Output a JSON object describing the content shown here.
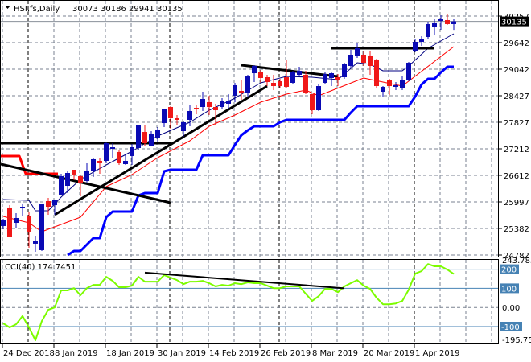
{
  "header": {
    "menu_icon": "triangle-down-icon",
    "symbol": "HSI,fs,Daily",
    "ohlc": "30073 30186 29941 30135"
  },
  "indicator_header": {
    "label": "CCI(40) 174.7451"
  },
  "colors": {
    "bull_candle": "#0a0ab4",
    "bear_candle": "#f01818",
    "fast_ma": "#000080",
    "slow_ma": "#ff0000",
    "lower_band": "#0000ff",
    "upper_band": "#ff0000",
    "trendline": "#000000",
    "cci_line": "#7cfc00",
    "cci_levels": "#4682b4",
    "grid": "#7a8290",
    "current_price_bg": "#000000"
  },
  "chart_data": [
    {
      "type": "candlestick",
      "title": "HSI,fs,Daily",
      "grid": true,
      "y_ticks": [
        30257,
        29642,
        29042,
        28427,
        27827,
        27212,
        26612,
        25997,
        25382,
        24782
      ],
      "ylim": [
        24782,
        30257
      ],
      "current_price": "30135",
      "x_tick_labels": [
        {
          "date": "2018-12-24",
          "label": "24 Dec 2018"
        },
        {
          "date": "2019-01-08",
          "label": "8 Jan 2019"
        },
        {
          "date": "2019-01-18",
          "label": "18 Jan 2019"
        },
        {
          "date": "2019-01-30",
          "label": "30 Jan 2019"
        },
        {
          "date": "2019-02-14",
          "label": "14 Feb 2019"
        },
        {
          "date": "2019-02-26",
          "label": "26 Feb 2019"
        },
        {
          "date": "2019-03-08",
          "label": "8 Mar 2019"
        },
        {
          "date": "2019-03-20",
          "label": "20 Mar 2019"
        },
        {
          "date": "2019-04-01",
          "label": "1 Apr 2019"
        }
      ],
      "month_separators": [
        "2019-01-02",
        "2019-02-01",
        "2019-03-01",
        "2019-04-01"
      ],
      "dates": [
        "2018-12-24",
        "2018-12-27",
        "2018-12-28",
        "2018-12-31",
        "2019-01-02",
        "2019-01-03",
        "2019-01-04",
        "2019-01-07",
        "2019-01-08",
        "2019-01-09",
        "2019-01-10",
        "2019-01-11",
        "2019-01-14",
        "2019-01-15",
        "2019-01-16",
        "2019-01-17",
        "2019-01-18",
        "2019-01-21",
        "2019-01-22",
        "2019-01-23",
        "2019-01-24",
        "2019-01-25",
        "2019-01-28",
        "2019-01-29",
        "2019-01-30",
        "2019-01-31",
        "2019-02-01",
        "2019-02-04",
        "2019-02-08",
        "2019-02-11",
        "2019-02-12",
        "2019-02-13",
        "2019-02-14",
        "2019-02-15",
        "2019-02-18",
        "2019-02-19",
        "2019-02-20",
        "2019-02-21",
        "2019-02-22",
        "2019-02-25",
        "2019-02-26",
        "2019-02-27",
        "2019-02-28",
        "2019-03-01",
        "2019-03-04",
        "2019-03-05",
        "2019-03-06",
        "2019-03-07",
        "2019-03-08",
        "2019-03-11",
        "2019-03-12",
        "2019-03-13",
        "2019-03-14",
        "2019-03-15",
        "2019-03-18",
        "2019-03-19",
        "2019-03-20",
        "2019-03-21",
        "2019-03-22",
        "2019-03-25",
        "2019-03-26",
        "2019-03-27",
        "2019-03-28",
        "2019-03-29",
        "2019-04-01",
        "2019-04-02",
        "2019-04-03",
        "2019-04-04",
        "2019-04-08",
        "2019-04-09",
        "2019-04-10"
      ],
      "ohlc": [
        [
          25446,
          25612,
          25372,
          25593
        ],
        [
          25870,
          25925,
          25188,
          25206
        ],
        [
          25519,
          25741,
          25409,
          25630
        ],
        [
          25851,
          25962,
          25685,
          25888
        ],
        [
          25685,
          25777,
          24948,
          25317
        ],
        [
          25041,
          25225,
          24856,
          25096
        ],
        [
          24893,
          25962,
          24875,
          25943
        ],
        [
          26017,
          26091,
          25704,
          25888
        ],
        [
          25925,
          26036,
          25704,
          26036
        ],
        [
          26165,
          26644,
          26146,
          26589
        ],
        [
          26367,
          26718,
          26202,
          26662
        ],
        [
          26736,
          26736,
          26497,
          26626
        ],
        [
          26589,
          26607,
          26128,
          26441
        ],
        [
          26478,
          26884,
          26441,
          26718
        ],
        [
          26699,
          26994,
          26570,
          26976
        ],
        [
          26939,
          27013,
          26644,
          26884
        ],
        [
          26939,
          27363,
          26884,
          27344
        ],
        [
          27215,
          27344,
          26994,
          27252
        ],
        [
          27142,
          27179,
          26847,
          26884
        ],
        [
          26865,
          27087,
          26847,
          26939
        ],
        [
          27050,
          27326,
          26847,
          27252
        ],
        [
          27234,
          27750,
          27179,
          27750
        ],
        [
          27602,
          27768,
          27271,
          27344
        ],
        [
          27289,
          27621,
          27271,
          27566
        ],
        [
          27455,
          27713,
          27363,
          27658
        ],
        [
          27805,
          28137,
          27713,
          28119
        ],
        [
          28174,
          28192,
          27676,
          27916
        ],
        [
          27916,
          27990,
          27750,
          27879
        ],
        [
          27621,
          27861,
          27492,
          27824
        ],
        [
          27879,
          28211,
          27731,
          28082
        ],
        [
          28155,
          28211,
          28008,
          28137
        ],
        [
          28174,
          28524,
          28082,
          28358
        ],
        [
          28285,
          28432,
          27990,
          28174
        ],
        [
          28174,
          28248,
          27768,
          28100
        ],
        [
          28174,
          28377,
          28119,
          28321
        ],
        [
          28248,
          28469,
          28137,
          28303
        ],
        [
          28432,
          28727,
          28285,
          28672
        ],
        [
          28543,
          28782,
          28340,
          28506
        ],
        [
          28506,
          28911,
          28414,
          28874
        ],
        [
          28948,
          29133,
          28745,
          29114
        ],
        [
          28985,
          29022,
          28727,
          28838
        ],
        [
          28856,
          28911,
          28653,
          28745
        ],
        [
          28727,
          28911,
          28561,
          28653
        ],
        [
          28764,
          28819,
          28598,
          28653
        ],
        [
          28856,
          29262,
          28598,
          28635
        ],
        [
          28727,
          29004,
          28709,
          28985
        ],
        [
          28911,
          29096,
          28874,
          29004
        ],
        [
          28911,
          29004,
          28469,
          28506
        ],
        [
          28469,
          28469,
          28008,
          28100
        ],
        [
          28100,
          28690,
          28082,
          28653
        ],
        [
          28727,
          28967,
          28709,
          28930
        ],
        [
          28838,
          28985,
          28653,
          28948
        ],
        [
          28856,
          28930,
          28653,
          28801
        ],
        [
          28856,
          29188,
          28819,
          29169
        ],
        [
          29114,
          29483,
          29077,
          29372
        ],
        [
          29354,
          29649,
          29298,
          29520
        ],
        [
          29372,
          29464,
          29114,
          29188
        ],
        [
          29354,
          29464,
          28911,
          29114
        ],
        [
          29262,
          29280,
          28616,
          28653
        ],
        [
          28524,
          28653,
          28395,
          28635
        ],
        [
          28782,
          28819,
          28451,
          28653
        ],
        [
          28635,
          28745,
          28561,
          28672
        ],
        [
          28598,
          28874,
          28561,
          28782
        ],
        [
          28782,
          29207,
          28764,
          29188
        ],
        [
          29446,
          29722,
          29427,
          29667
        ],
        [
          29667,
          29796,
          29575,
          29722
        ],
        [
          29778,
          30128,
          29741,
          30073
        ],
        [
          30017,
          30202,
          29815,
          30110
        ],
        [
          30146,
          30275,
          29944,
          30183
        ],
        [
          30165,
          30294,
          30054,
          30073
        ],
        [
          30073,
          30186,
          29941,
          30135
        ]
      ],
      "fast_ma": [
        [
          "2018-12-24",
          26054
        ],
        [
          "2019-01-02",
          26036
        ],
        [
          "2019-01-03",
          25796
        ],
        [
          "2019-01-07",
          25796
        ],
        [
          "2019-01-09",
          26110
        ],
        [
          "2019-01-14",
          26515
        ],
        [
          "2019-01-18",
          26847
        ],
        [
          "2019-01-24",
          27160
        ],
        [
          "2019-01-30",
          27510
        ],
        [
          "2019-02-11",
          27824
        ],
        [
          "2019-02-14",
          28100
        ],
        [
          "2019-02-20",
          28377
        ],
        [
          "2019-02-26",
          28727
        ],
        [
          "2019-03-04",
          28874
        ],
        [
          "2019-03-08",
          28856
        ],
        [
          "2019-03-14",
          28801
        ],
        [
          "2019-03-19",
          29188
        ],
        [
          "2019-03-21",
          29151
        ],
        [
          "2019-03-25",
          29004
        ],
        [
          "2019-03-28",
          29004
        ],
        [
          "2019-03-29",
          29114
        ],
        [
          "2019-04-03",
          29520
        ],
        [
          "2019-04-10",
          29852
        ]
      ],
      "slow_ma": [
        [
          "2018-12-24",
          25667
        ],
        [
          "2019-01-02",
          25519
        ],
        [
          "2019-01-04",
          25317
        ],
        [
          "2019-01-08",
          25427
        ],
        [
          "2019-01-14",
          25649
        ],
        [
          "2019-01-18",
          26349
        ],
        [
          "2019-01-24",
          26626
        ],
        [
          "2019-01-30",
          27013
        ],
        [
          "2019-02-11",
          27400
        ],
        [
          "2019-02-14",
          27731
        ],
        [
          "2019-02-20",
          27990
        ],
        [
          "2019-02-26",
          28285
        ],
        [
          "2019-03-04",
          28469
        ],
        [
          "2019-03-07",
          28561
        ],
        [
          "2019-03-11",
          28432
        ],
        [
          "2019-03-20",
          28838
        ],
        [
          "2019-03-28",
          28653
        ],
        [
          "2019-04-10",
          29556
        ]
      ],
      "lower_band": [
        null,
        null,
        null,
        null,
        null,
        null,
        null,
        null,
        null,
        null,
        24782,
        24875,
        24875,
        25022,
        25169,
        25169,
        25649,
        25778,
        25778,
        25778,
        25778,
        26146,
        26202,
        26202,
        26202,
        26699,
        26736,
        26736,
        26736,
        26736,
        26736,
        27068,
        27068,
        27068,
        27068,
        27068,
        27307,
        27529,
        27639,
        27731,
        27731,
        27731,
        27731,
        27824,
        27879,
        27879,
        27879,
        27879,
        27879,
        27879,
        27879,
        27879,
        27879,
        27879,
        28045,
        28192,
        28192,
        28192,
        28192,
        28192,
        28192,
        28192,
        28192,
        28192,
        28414,
        28690,
        28819,
        28819,
        28967,
        29096,
        29096
      ],
      "upper_band": [
        27050,
        27050,
        27050,
        27050,
        26644,
        26644,
        26644,
        26644,
        26644,
        26644
      ],
      "trendlines": [
        {
          "from": [
            "2018-12-24",
            27344
          ],
          "to": [
            "2019-02-01",
            27344
          ]
        },
        {
          "from": [
            "2018-12-24",
            26865
          ],
          "to": [
            "2019-02-01",
            25980
          ]
        },
        {
          "from": [
            "2019-01-08",
            25704
          ],
          "to": [
            "2019-02-27",
            28653
          ]
        },
        {
          "from": [
            "2019-02-21",
            29133
          ],
          "to": [
            "2019-03-14",
            28874
          ]
        },
        {
          "from": [
            "2019-03-13",
            29520
          ],
          "to": [
            "2019-04-04",
            29520
          ]
        }
      ]
    },
    {
      "type": "line",
      "title": "CCI(40) 174.7451",
      "ylim": [
        -195.757,
        243.7856
      ],
      "y_tick_labels": [
        "243.7856",
        "0.00",
        "-195.757"
      ],
      "levels": [
        200,
        100,
        -100
      ],
      "level_labels": [
        "200",
        "100",
        "-100"
      ],
      "values": [
        -83,
        -104,
        -88,
        -45,
        -104,
        -172,
        -71,
        -12,
        0,
        89,
        89,
        101,
        64,
        101,
        118,
        118,
        160,
        139,
        106,
        106,
        114,
        160,
        135,
        135,
        135,
        169,
        156,
        143,
        122,
        135,
        135,
        139,
        127,
        110,
        118,
        114,
        127,
        122,
        131,
        127,
        127,
        114,
        101,
        101,
        110,
        110,
        110,
        72,
        34,
        59,
        97,
        97,
        80,
        110,
        127,
        143,
        114,
        97,
        51,
        17,
        17,
        21,
        34,
        93,
        177,
        190,
        227,
        215,
        215,
        198,
        174.7451
      ],
      "trendlines": [
        {
          "from": [
            "2019-01-28",
            182
          ],
          "to": [
            "2019-03-15",
            100
          ]
        }
      ]
    }
  ]
}
